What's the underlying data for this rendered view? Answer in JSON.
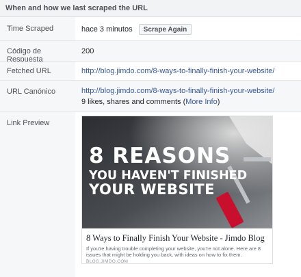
{
  "section_title": "When and how we last scraped the URL",
  "rows": {
    "time_scraped": {
      "label": "Time Scraped",
      "value": "hace 3 minutos",
      "button": "Scrape Again"
    },
    "response_code": {
      "label": "Código de Respuesta",
      "value": "200"
    },
    "fetched_url": {
      "label": "Fetched URL",
      "value": "http://blog.jimdo.com/8-ways-to-finally-finish-your-website/"
    },
    "canonical_url": {
      "label": "URL Canónico",
      "value": "http://blog.jimdo.com/8-ways-to-finally-finish-your-website/",
      "stats_prefix": "9 likes, shares and comments (",
      "more_info": "More Info",
      "stats_suffix": ")"
    },
    "link_preview": {
      "label": "Link Preview"
    }
  },
  "preview": {
    "image_line1": "8 REASONS",
    "image_line2": "YOU HAVEN'T FINISHED",
    "image_line3": "YOUR WEBSITE",
    "title": "8 Ways to Finally Finish Your Website - Jimdo Blog",
    "description": "If you're having trouble completing your website, you're not alone. Here are 8 issues that might be holding you back, with ideas on how to fix them.",
    "domain": "BLOG.JIMDO.COM"
  },
  "colors": {
    "link": "#385898",
    "label_bg": "#f6f7f9",
    "header_bg": "#f2f3f5"
  }
}
